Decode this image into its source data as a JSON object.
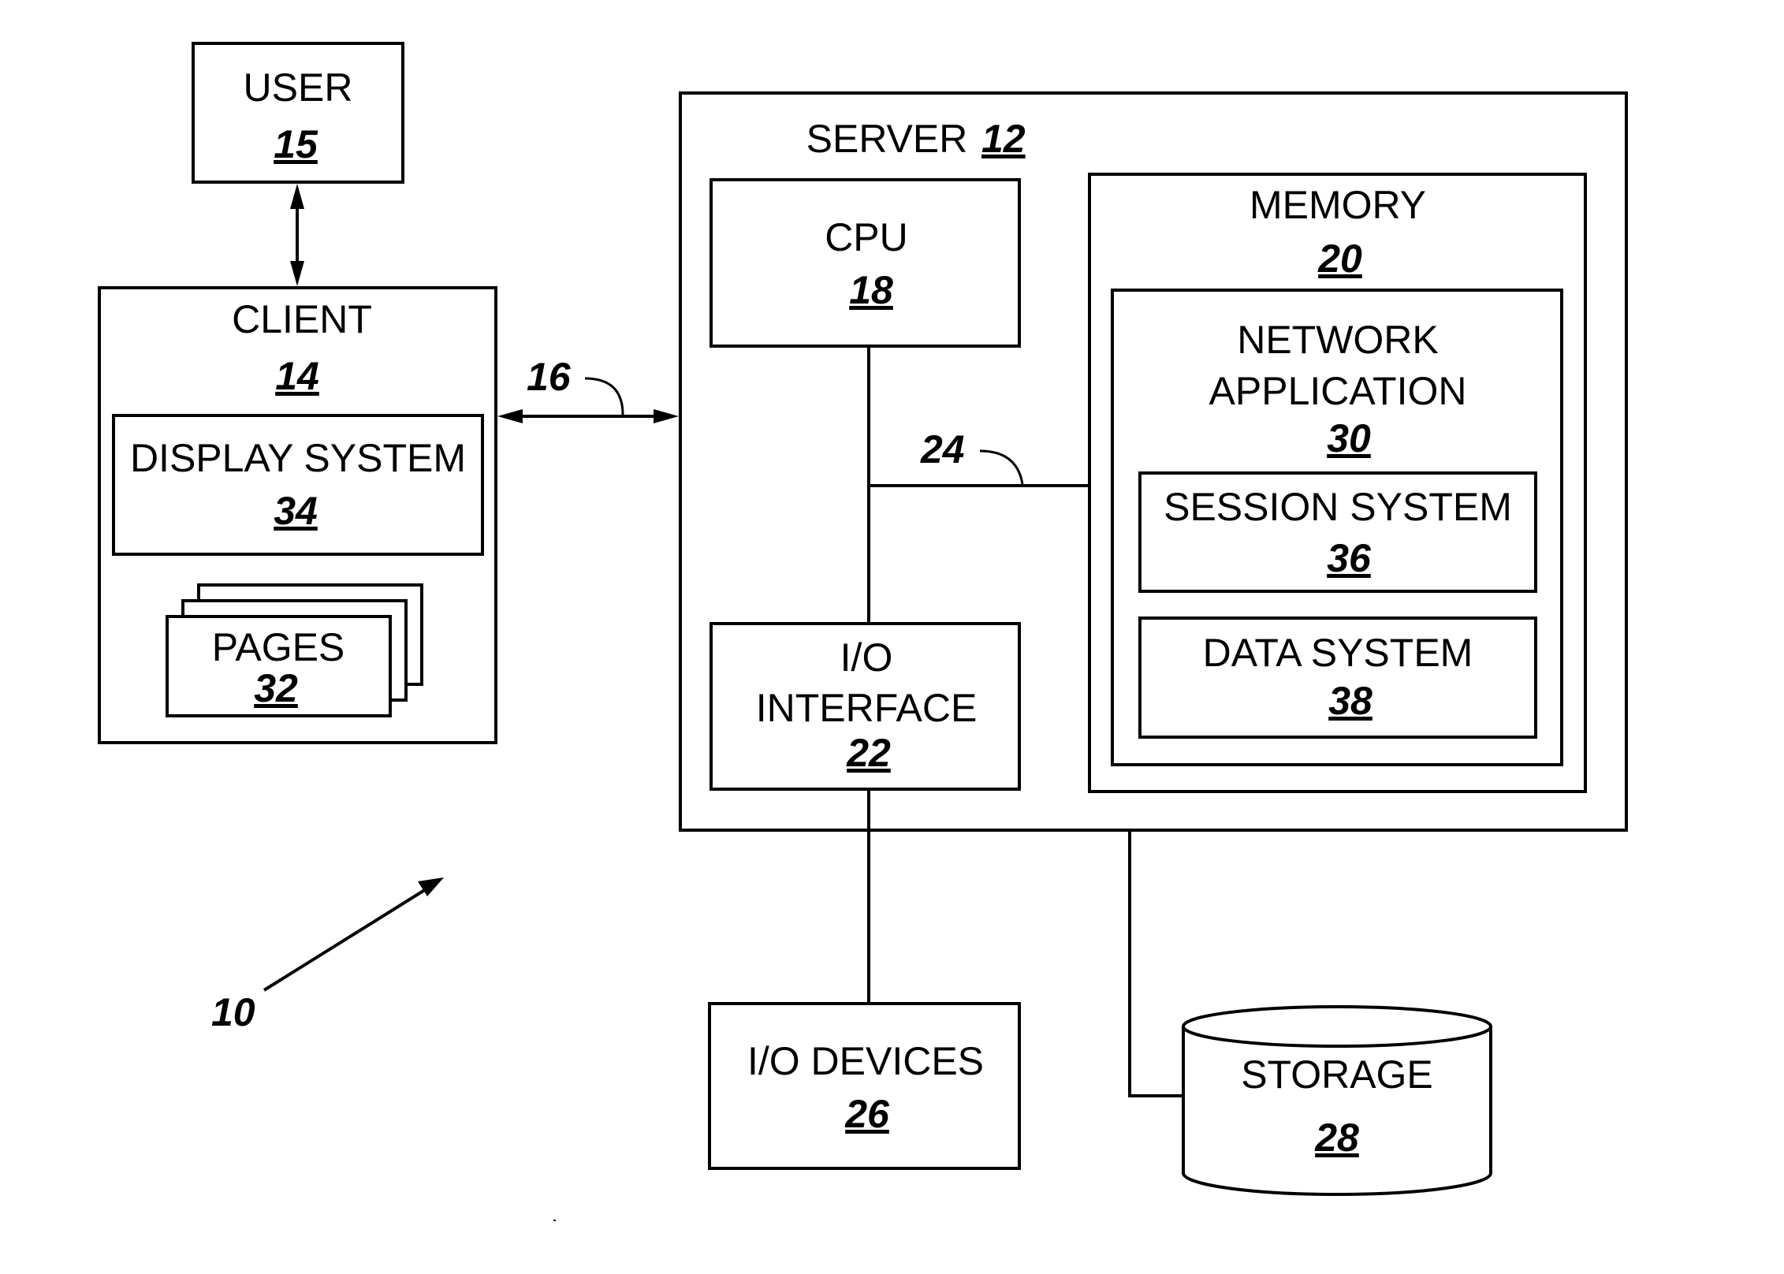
{
  "figure": {
    "reference": "10",
    "components": {
      "user": {
        "label": "USER",
        "number": "15"
      },
      "client": {
        "label": "CLIENT",
        "number": "14"
      },
      "display_system": {
        "label": "DISPLAY SYSTEM",
        "number": "34"
      },
      "pages": {
        "label": "PAGES",
        "number": "32"
      },
      "server": {
        "label": "SERVER",
        "number": "12"
      },
      "cpu": {
        "label": "CPU",
        "number": "18"
      },
      "io_interface": {
        "label_line1": "I/O",
        "label_line2": "INTERFACE",
        "number": "22"
      },
      "memory": {
        "label": "MEMORY",
        "number": "20"
      },
      "network_application": {
        "label_line1": "NETWORK",
        "label_line2": "APPLICATION",
        "number": "30"
      },
      "session_system": {
        "label": "SESSION SYSTEM",
        "number": "36"
      },
      "data_system": {
        "label": "DATA SYSTEM",
        "number": "38"
      },
      "io_devices": {
        "label": "I/O DEVICES",
        "number": "26"
      },
      "storage": {
        "label": "STORAGE",
        "number": "28"
      }
    },
    "connections": {
      "network_link": {
        "number": "16"
      },
      "bus": {
        "number": "24"
      }
    }
  }
}
